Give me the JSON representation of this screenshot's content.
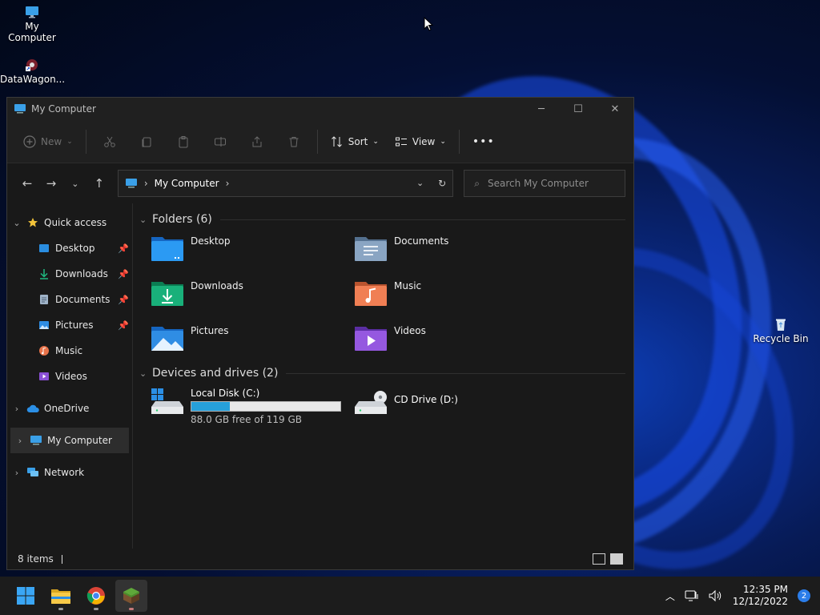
{
  "desktop": {
    "icons": [
      {
        "label": "My Computer"
      },
      {
        "label": "DataWagon..."
      },
      {
        "label": "Recycle Bin"
      }
    ]
  },
  "window": {
    "title": "My Computer",
    "controls": {
      "minimize": "─",
      "maximize": "☐",
      "close": "✕"
    }
  },
  "toolbar": {
    "new_label": "New",
    "sort_label": "Sort",
    "view_label": "View",
    "more_label": "•••"
  },
  "nav": {
    "breadcrumb": "My Computer",
    "search_placeholder": "Search My Computer"
  },
  "sidebar": {
    "quick_access": "Quick access",
    "items": [
      {
        "label": "Desktop",
        "pinned": true
      },
      {
        "label": "Downloads",
        "pinned": true
      },
      {
        "label": "Documents",
        "pinned": true
      },
      {
        "label": "Pictures",
        "pinned": true
      },
      {
        "label": "Music",
        "pinned": false
      },
      {
        "label": "Videos",
        "pinned": false
      }
    ],
    "onedrive": "OneDrive",
    "my_computer": "My Computer",
    "network": "Network"
  },
  "content": {
    "folders_heading": "Folders (6)",
    "folders": [
      {
        "name": "Desktop",
        "color": "#1e88e5"
      },
      {
        "name": "Documents",
        "color": "#6f8fb3"
      },
      {
        "name": "Downloads",
        "color": "#13a872"
      },
      {
        "name": "Music",
        "color": "#e8734a"
      },
      {
        "name": "Pictures",
        "color": "#2f8de4"
      },
      {
        "name": "Videos",
        "color": "#8a4fd6"
      }
    ],
    "devices_heading": "Devices and drives (2)",
    "drives": [
      {
        "name": "Local Disk (C:)",
        "free_text": "88.0 GB free of 119 GB",
        "used_fraction": 0.26
      },
      {
        "name": "CD Drive (D:)"
      }
    ]
  },
  "status": {
    "items_count": "8 items"
  },
  "taskbar": {
    "time": "12:35 PM",
    "date": "12/12/2022",
    "notifications": "2"
  }
}
